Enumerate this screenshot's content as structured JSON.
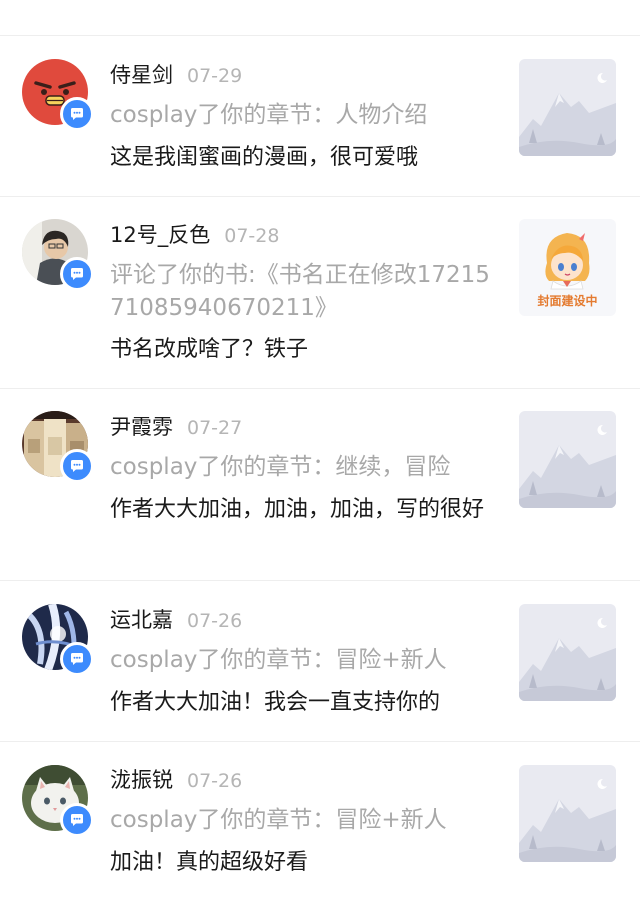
{
  "notifications": [
    {
      "name": "侍星剑",
      "date": "07-29",
      "action": "cosplay了你的章节：人物介绍",
      "comment": "这是我闺蜜画的漫画，很可爱哦",
      "avatar_icon": "red-cartoon-face",
      "thumbnail_icon": "mountain-placeholder-icon"
    },
    {
      "name": "12号_反色",
      "date": "07-28",
      "action": "评论了你的书:《书名正在修改1721571085940670211》",
      "comment": "书名改成啥了？铁子",
      "avatar_icon": "person-photo",
      "thumbnail_icon": "anime-girl-cover-icon",
      "thumbnail_label": "封面建设中"
    },
    {
      "name": "尹霞雰",
      "date": "07-27",
      "action": "cosplay了你的章节：继续，冒险",
      "comment": "作者大大加油，加油，加油，写的很好",
      "avatar_icon": "bottles-photo",
      "thumbnail_icon": "mountain-placeholder-icon"
    },
    {
      "name": "运北嘉",
      "date": "07-26",
      "action": "cosplay了你的章节：冒险+新人",
      "comment": "作者大大加油！我会一直支持你的",
      "avatar_icon": "blue-ink-artwork",
      "thumbnail_icon": "mountain-placeholder-icon"
    },
    {
      "name": "泷振锐",
      "date": "07-26",
      "action": "cosplay了你的章节：冒险+新人",
      "comment": "加油！真的超级好看",
      "avatar_icon": "white-cat-photo",
      "thumbnail_icon": "mountain-placeholder-icon"
    }
  ],
  "colors": {
    "badge": "#3d8bfd",
    "secondary_text": "#a8a8a8",
    "primary_text": "#1a1a1a",
    "cover_label": "#e47b30"
  }
}
